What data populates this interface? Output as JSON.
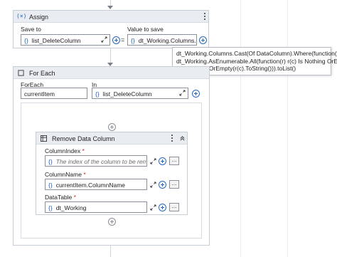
{
  "assign": {
    "title": "Assign",
    "save_to_label": "Save to",
    "save_to_value": "list_DeleteColumn",
    "equals": "=",
    "value_label": "Value to save",
    "value_value": "dt_Working.Columns.C"
  },
  "tooltip": {
    "lines": [
      "dt_Working.Columns.Cast(Of DataColumn).Where(function(c)",
      "dt_Working.AsEnumerable.All(function(r) r(c) Is Nothing OrElse",
      "String.IsNullOrEmpty(r(c).ToString())).toList()"
    ]
  },
  "foreach": {
    "title": "For Each",
    "foreach_label": "ForEach",
    "foreach_value": "currentItem",
    "in_label": "In",
    "in_value": "list_DeleteColumn"
  },
  "remove": {
    "title": "Remove Data Column",
    "column_index_label": "ColumnIndex",
    "column_index_placeholder": "The index of the column to be removec",
    "column_name_label": "ColumnName",
    "column_name_value": "currentItem.ColumnName",
    "datatable_label": "DataTable",
    "datatable_value": "dt_Working",
    "required_mark": "*"
  },
  "common": {
    "curly": "{}",
    "more": "..."
  },
  "icons": {
    "assign": "assign-icon",
    "foreach": "foreach-icon",
    "remove": "remove-data-column-icon",
    "expand": "expand-editor-icon",
    "add": "add-circle-icon",
    "kebab": "kebab-menu-icon",
    "collapse": "collapse-icon"
  },
  "colors": {
    "accent": "#2466c4",
    "header_bg": "#e9edf2",
    "required": "#c42b1c"
  }
}
